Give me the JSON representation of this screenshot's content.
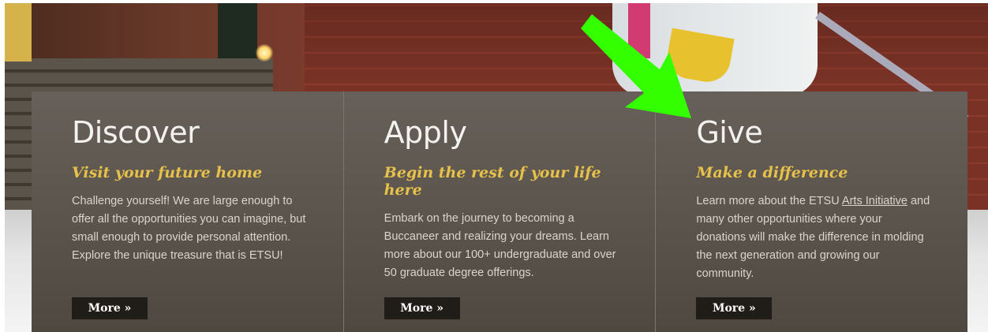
{
  "panels": [
    {
      "title": "Discover",
      "subtitle": "Visit your future home",
      "body": "Challenge yourself! We are large enough to offer all the opportunities you can imagine, but small enough to provide personal attention. Explore the unique treasure that is ETSU!",
      "more_label": "More »"
    },
    {
      "title": "Apply",
      "subtitle": "Begin the rest of your life here",
      "body": "Embark on the journey to becoming a Buccaneer and realizing your dreams. Learn more about our 100+ undergraduate and over 50 graduate degree offerings.",
      "more_label": "More »"
    },
    {
      "title": "Give",
      "subtitle": "Make a difference",
      "body_before": "Learn more about the ETSU ",
      "link_text": "Arts Initiative",
      "body_after": " and many other opportunities where your donations will make the difference in molding the next generation and growing our community.",
      "more_label": "More »"
    }
  ],
  "colors": {
    "accent_gold": "#e6c24a",
    "panel_bg": "#5c554d",
    "button_bg": "#201c18",
    "arrow_green": "#33ff00"
  },
  "icons": {
    "annotation": "arrow-down-right-icon"
  }
}
